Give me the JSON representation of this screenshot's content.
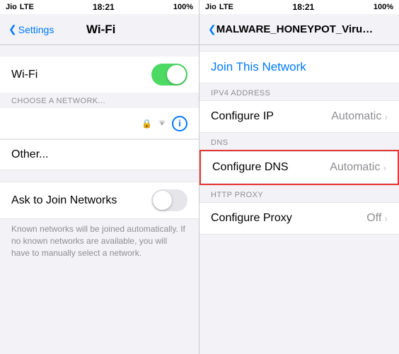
{
  "left": {
    "status_bar": {
      "carrier": "Jio",
      "signal": "LTE",
      "time": "18:21",
      "battery": "100%"
    },
    "nav": {
      "back_label": "Settings",
      "title": "Wi-Fi"
    },
    "wifi_toggle": {
      "label": "Wi-Fi",
      "state": "on"
    },
    "section_header": "CHOOSE A NETWORK...",
    "other_label": "Other...",
    "ask_to_join": {
      "label": "Ask to Join Networks",
      "state": "off"
    },
    "description": "Known networks will be joined automatically. If no known networks are available, you will have to manually select a network."
  },
  "right": {
    "status_bar": {
      "carrier": "Jio",
      "signal": "LTE",
      "time": "18:21",
      "battery": "100%"
    },
    "nav": {
      "title": "MALWARE_HONEYPOT_Virus_Detected"
    },
    "join_link": "Join This Network",
    "ipv4_section": "IPV4 ADDRESS",
    "configure_ip": {
      "label": "Configure IP",
      "value": "Automatic"
    },
    "dns_section": "DNS",
    "configure_dns": {
      "label": "Configure DNS",
      "value": "Automatic"
    },
    "http_section": "HTTP PROXY",
    "configure_proxy": {
      "label": "Configure Proxy",
      "value": "Off"
    }
  }
}
